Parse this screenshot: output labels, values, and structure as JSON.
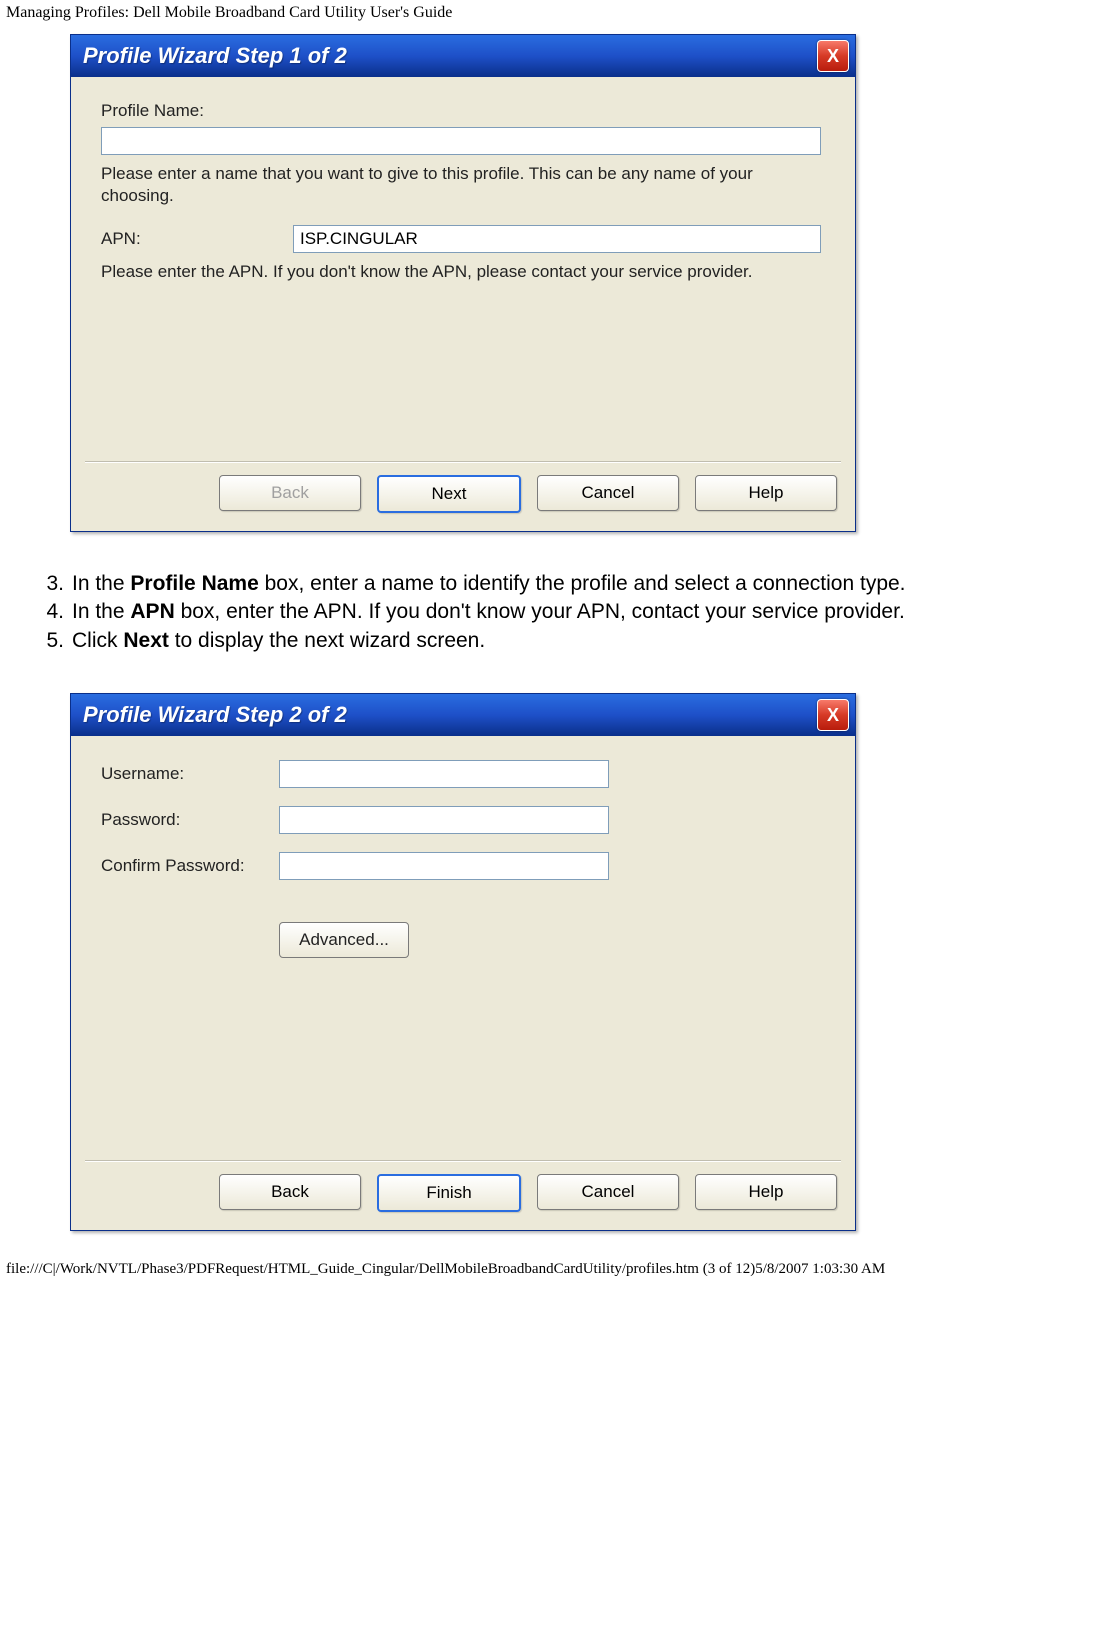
{
  "header": "Managing Profiles: Dell Mobile Broadband Card Utility User's Guide",
  "dialog1": {
    "title": "Profile Wizard Step 1 of 2",
    "close": "X",
    "profile_name_label": "Profile Name:",
    "profile_name_value": "",
    "profile_name_help": "Please enter a name that you want to give to this profile. This can be any name of your choosing.",
    "apn_label": "APN:",
    "apn_value": "ISP.CINGULAR",
    "apn_help": "Please enter the APN.  If you don't know the APN, please contact your service provider.",
    "buttons": {
      "back": "Back",
      "next": "Next",
      "cancel": "Cancel",
      "help": "Help"
    }
  },
  "steps": {
    "s3_num": "3.",
    "s3_pre": "In the ",
    "s3_bold": "Profile Name",
    "s3_post": " box, enter a name to identify the profile and select a connection type.",
    "s4_num": "4.",
    "s4_pre": "In the ",
    "s4_bold": "APN",
    "s4_post": " box, enter the APN. If you don't know your APN, contact your service provider.",
    "s5_num": "5.",
    "s5_pre": "Click ",
    "s5_bold": "Next",
    "s5_post": " to display the next wizard screen."
  },
  "dialog2": {
    "title": "Profile Wizard Step 2 of 2",
    "close": "X",
    "username_label": "Username:",
    "username_value": "",
    "password_label": "Password:",
    "password_value": "",
    "confirm_label": "Confirm Password:",
    "confirm_value": "",
    "advanced": "Advanced...",
    "buttons": {
      "back": "Back",
      "finish": "Finish",
      "cancel": "Cancel",
      "help": "Help"
    }
  },
  "footer": "file:///C|/Work/NVTL/Phase3/PDFRequest/HTML_Guide_Cingular/DellMobileBroadbandCardUtility/profiles.htm (3 of 12)5/8/2007 1:03:30 AM"
}
